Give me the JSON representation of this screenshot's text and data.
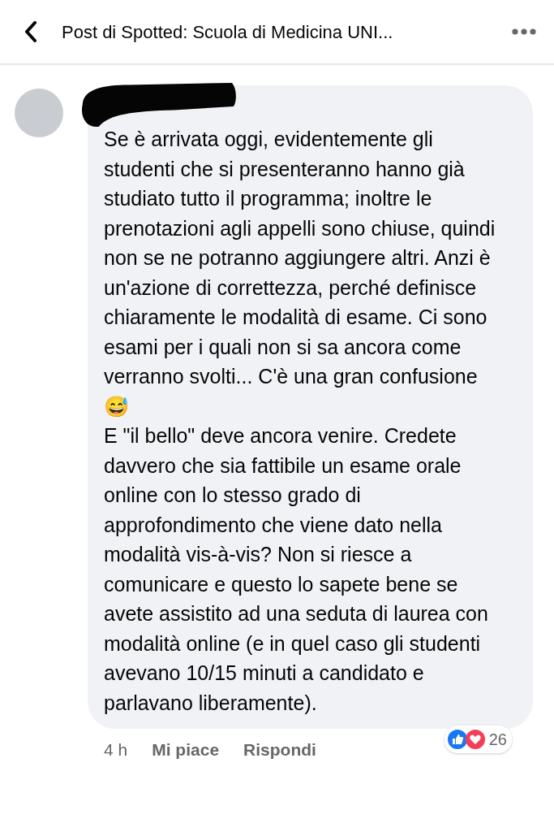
{
  "header": {
    "title": "Post di Spotted: Scuola di Medicina UNI..."
  },
  "comment": {
    "paragraphs": [
      "Se è arrivata oggi, evidentemente gli studenti che si presenteranno hanno già studiato tutto il programma; inoltre le prenotazioni agli appelli sono chiuse, quindi non se ne potranno aggiungere altri. Anzi è un'azione di correttezza, perché definisce chiaramente le modalità di esame. Ci sono esami per i quali non si sa ancora come verranno svolti... C'è una gran confusione 😅",
      "E \"il bello\" deve ancora venire. Credete davvero che sia fattibile un esame orale online con lo stesso grado di approfondimento che viene dato nella modalità vis-à-vis? Non si riesce a comunicare e questo lo sapete bene se avete assistito ad una seduta di laurea con modalità online (e in quel caso gli studenti avevano 10/15 minuti a candidato e parlavano liberamente)."
    ],
    "time": "4 h",
    "actions": [
      "Mi piace",
      "Rispondi"
    ],
    "reaction_count": "26"
  }
}
